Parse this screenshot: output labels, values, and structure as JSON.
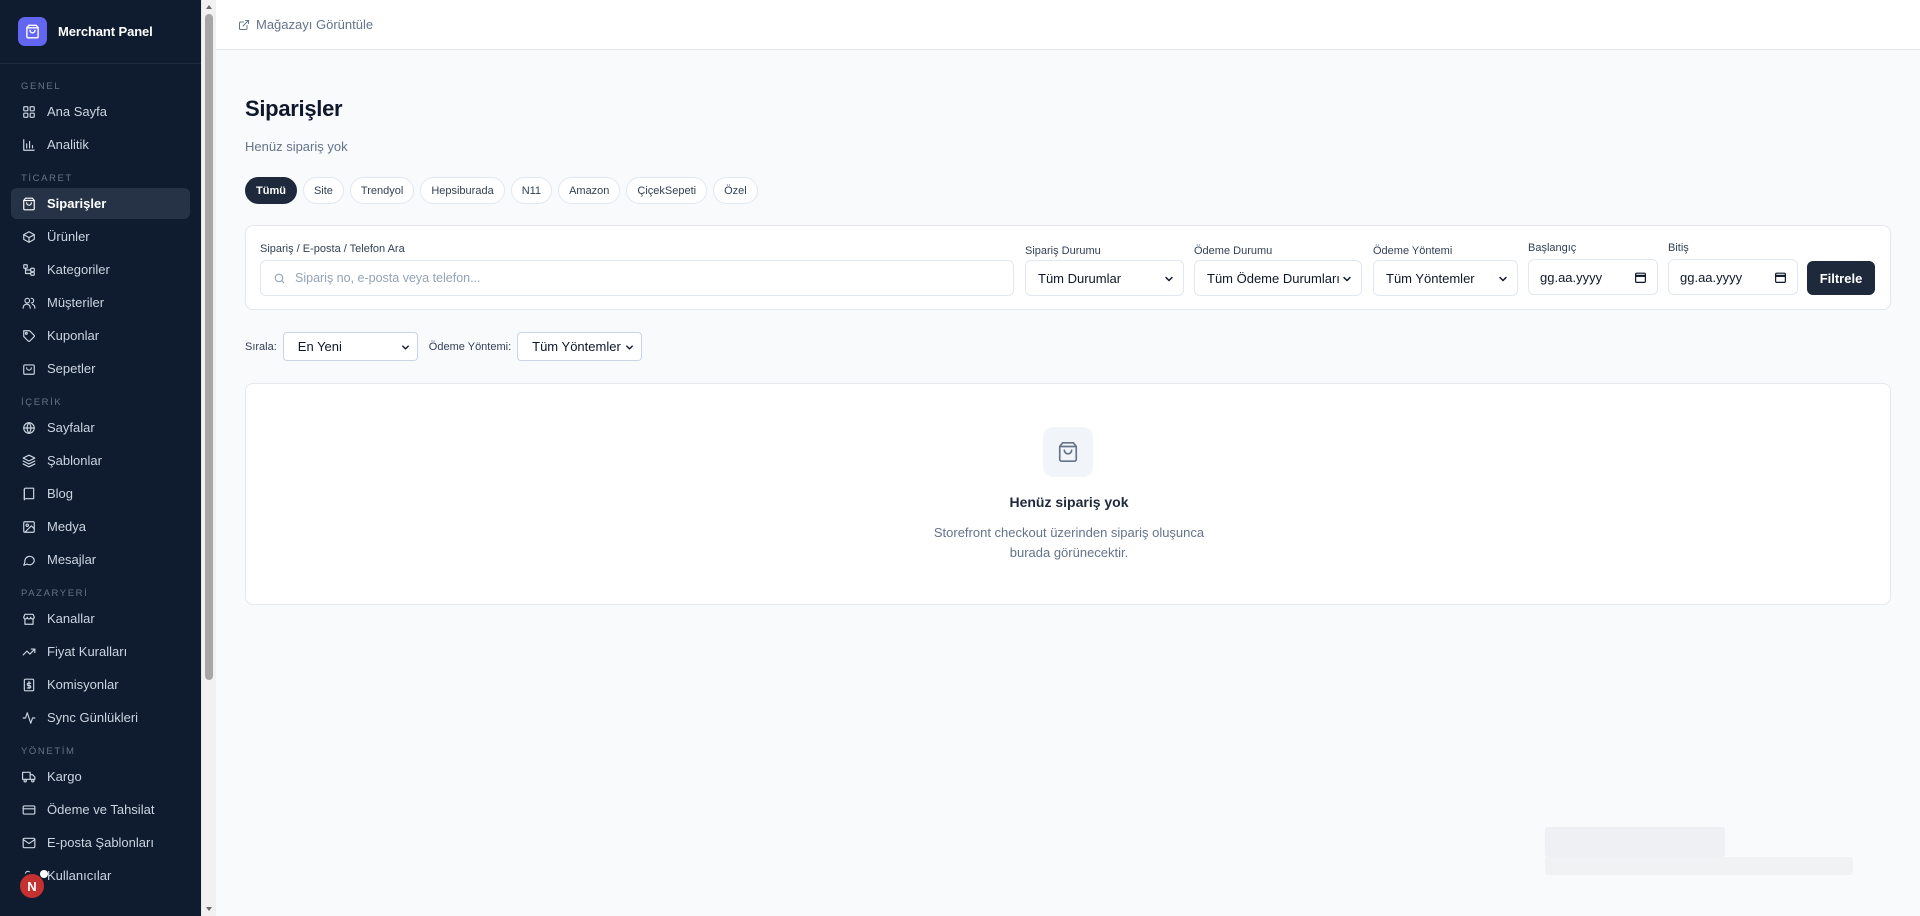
{
  "brand": {
    "name": "Merchant Panel"
  },
  "sidebar": {
    "sections": [
      {
        "label": "GENEL",
        "items": [
          {
            "label": "Ana Sayfa",
            "icon": "grid-icon"
          },
          {
            "label": "Analitik",
            "icon": "bar-chart-icon"
          }
        ]
      },
      {
        "label": "TİCARET",
        "items": [
          {
            "label": "Siparişler",
            "icon": "shopping-bag-icon",
            "active": true
          },
          {
            "label": "Ürünler",
            "icon": "box-icon"
          },
          {
            "label": "Kategoriler",
            "icon": "tree-icon"
          },
          {
            "label": "Müşteriler",
            "icon": "users-icon"
          },
          {
            "label": "Kuponlar",
            "icon": "tag-icon"
          },
          {
            "label": "Sepetler",
            "icon": "basket-icon"
          }
        ]
      },
      {
        "label": "İÇERİK",
        "items": [
          {
            "label": "Sayfalar",
            "icon": "globe-icon"
          },
          {
            "label": "Şablonlar",
            "icon": "layers-icon"
          },
          {
            "label": "Blog",
            "icon": "book-icon"
          },
          {
            "label": "Medya",
            "icon": "image-icon"
          },
          {
            "label": "Mesajlar",
            "icon": "message-icon"
          }
        ]
      },
      {
        "label": "PAZARYERİ",
        "items": [
          {
            "label": "Kanallar",
            "icon": "store-icon"
          },
          {
            "label": "Fiyat Kuralları",
            "icon": "trending-up-icon"
          },
          {
            "label": "Komisyonlar",
            "icon": "receipt-icon"
          },
          {
            "label": "Sync Günlükleri",
            "icon": "activity-icon"
          }
        ]
      },
      {
        "label": "YÖNETİM",
        "items": [
          {
            "label": "Kargo",
            "icon": "truck-icon"
          },
          {
            "label": "Ödeme ve Tahsilat",
            "icon": "credit-card-icon"
          },
          {
            "label": "E-posta Şablonları",
            "icon": "mail-icon"
          },
          {
            "label": "Kullanıcılar",
            "icon": "user-cog-icon"
          }
        ]
      }
    ],
    "avatar_letter": "N"
  },
  "topbar": {
    "store_link": "Mağazayı Görüntüle"
  },
  "page": {
    "title": "Siparişler",
    "subtitle": "Henüz sipariş yok"
  },
  "tabs": [
    "Tümü",
    "Site",
    "Trendyol",
    "Hepsiburada",
    "N11",
    "Amazon",
    "ÇiçekSepeti",
    "Özel"
  ],
  "filters": {
    "search_label": "Sipariş / E-posta / Telefon Ara",
    "search_placeholder": "Sipariş no, e-posta veya telefon...",
    "order_status_label": "Sipariş Durumu",
    "order_status_value": "Tüm Durumlar",
    "payment_status_label": "Ödeme Durumu",
    "payment_status_value": "Tüm Ödeme Durumları",
    "payment_method_label": "Ödeme Yöntemi",
    "payment_method_value": "Tüm Yöntemler",
    "start_label": "Başlangıç",
    "start_placeholder": "gg.aa.yyyy",
    "end_label": "Bitiş",
    "end_placeholder": "gg.aa.yyyy",
    "submit_label": "Filtrele"
  },
  "sort": {
    "sort_label": "Sırala:",
    "sort_value": "En Yeni",
    "method_label": "Ödeme Yöntemi:",
    "method_value": "Tüm Yöntemler"
  },
  "empty_state": {
    "title": "Henüz sipariş yok",
    "description": "Storefront checkout üzerinden sipariş oluşunca burada görünecektir."
  },
  "colors": {
    "sidebar_bg": "#0f1b2e",
    "accent": "#6366f1",
    "primary_button": "#1e293b"
  }
}
